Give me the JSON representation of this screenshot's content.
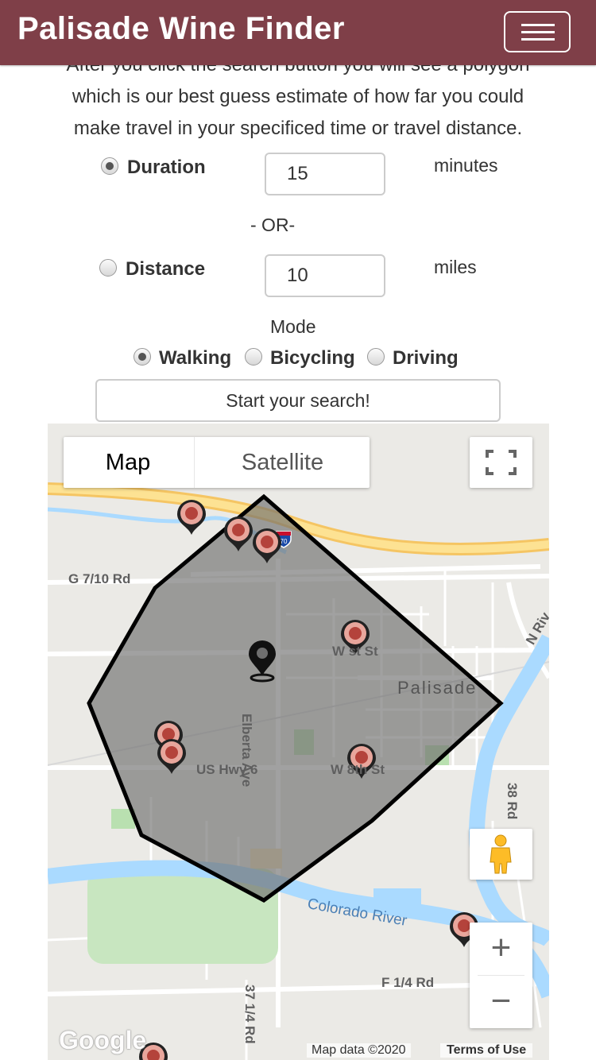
{
  "app": {
    "title": "Palisade Wine Finder"
  },
  "intro": {
    "line1": "After you click the search button you will see a polygon",
    "line2": "which is our best guess estimate of how far you could",
    "line3": "make travel in your specificed time or travel distance."
  },
  "form": {
    "duration": {
      "label": "Duration",
      "value": "15",
      "unit": "minutes",
      "checked": true
    },
    "or_text": "- OR-",
    "distance": {
      "label": "Distance",
      "value": "10",
      "unit": "miles",
      "checked": false
    },
    "mode": {
      "label": "Mode",
      "options": [
        {
          "label": "Walking",
          "checked": true
        },
        {
          "label": "Bicycling",
          "checked": false
        },
        {
          "label": "Driving",
          "checked": false
        }
      ]
    },
    "search_label": "Start your search!"
  },
  "map": {
    "type_map": "Map",
    "type_satellite": "Satellite",
    "labels": {
      "g_rd": "G 7/10 Rd",
      "west_st": "W st St",
      "palisade": "Palisade",
      "elberta": "Elberta Ave",
      "us6": "US Hwy 6",
      "w8th": "W 8th St",
      "rd38": "38 Rd",
      "colorado": "Colorado River",
      "f14": "F 1/4 Rd",
      "rd3714": "37 1/4 Rd",
      "n_riv": "N Riv"
    },
    "highway_shield": "70",
    "logo": "Google",
    "attribution": "Map data ©2020",
    "terms": "Terms of Use",
    "zoom_in": "+",
    "zoom_out": "−",
    "colors": {
      "river": "#aadaff",
      "park": "#c8e6c0",
      "highway": "#fcd96b",
      "isochrone": "#6f6f6f"
    }
  }
}
